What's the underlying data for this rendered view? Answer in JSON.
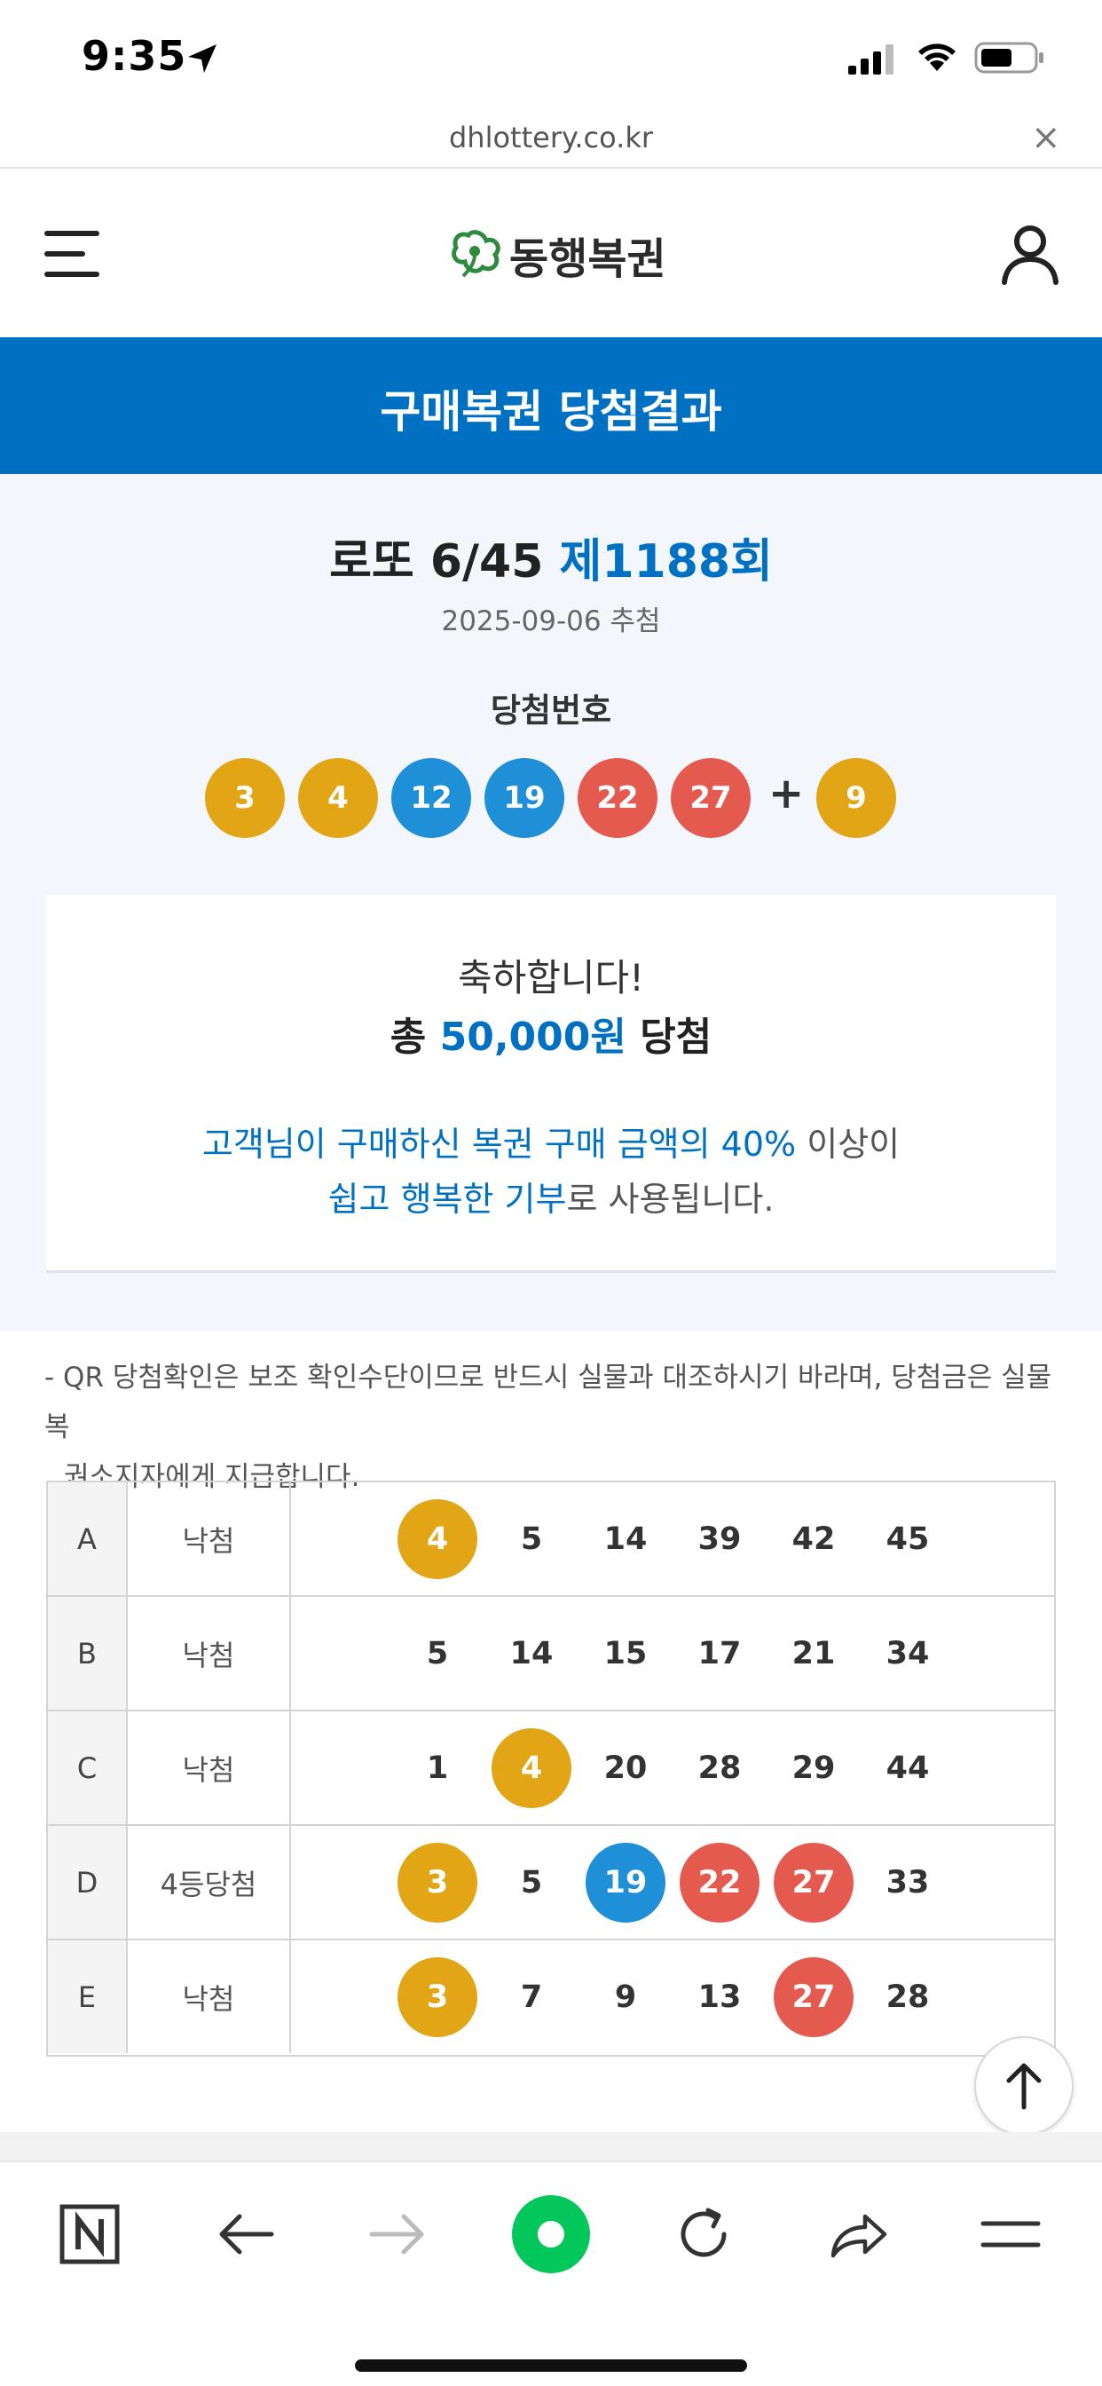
{
  "status_bar": {
    "time": "9:35"
  },
  "browser": {
    "url": "dhlottery.co.kr",
    "close_symbol": "×"
  },
  "header": {
    "logo_text": "동행복권"
  },
  "page_title": "구매복권 당첨결과",
  "draw": {
    "game_name": "로또 6/45",
    "round": "제1188회",
    "date": "2025-09-06 추첨",
    "winning_label": "당첨번호",
    "numbers": [
      "3",
      "4",
      "12",
      "19",
      "22",
      "27"
    ],
    "plus": "+",
    "bonus": "9"
  },
  "congrats": {
    "line1": "축하합니다!",
    "total_prefix": "총",
    "amount": "50,000원",
    "total_suffix": "당첨",
    "donation_hl1": "고객님이 구매하신 복권 구매 금액의 40%",
    "donation_text1": "이상이",
    "donation_hl2": "쉽고 행복한 기부",
    "donation_text2": "로 사용됩니다."
  },
  "notice": {
    "line1": "- QR 당첨확인은 보조 확인수단이므로 반드시 실물과 대조하시기 바라며, 당첨금은 실물 복",
    "line2": "권소지자에게 지급합니다."
  },
  "games": [
    {
      "id": "A",
      "result": "낙첨",
      "numbers": [
        "4",
        "5",
        "14",
        "39",
        "42",
        "45"
      ],
      "hits": [
        true,
        false,
        false,
        false,
        false,
        false
      ]
    },
    {
      "id": "B",
      "result": "낙첨",
      "numbers": [
        "5",
        "14",
        "15",
        "17",
        "21",
        "34"
      ],
      "hits": [
        false,
        false,
        false,
        false,
        false,
        false
      ]
    },
    {
      "id": "C",
      "result": "낙첨",
      "numbers": [
        "1",
        "4",
        "20",
        "28",
        "29",
        "44"
      ],
      "hits": [
        false,
        true,
        false,
        false,
        false,
        false
      ]
    },
    {
      "id": "D",
      "result": "4등당첨",
      "numbers": [
        "3",
        "5",
        "19",
        "22",
        "27",
        "33"
      ],
      "hits": [
        true,
        false,
        true,
        true,
        true,
        false
      ]
    },
    {
      "id": "E",
      "result": "낙첨",
      "numbers": [
        "3",
        "7",
        "9",
        "13",
        "27",
        "28"
      ],
      "hits": [
        true,
        false,
        false,
        false,
        true,
        false
      ]
    }
  ],
  "colors": {
    "brand_blue": "#0071c2",
    "ball_yellow": "#e2a516",
    "ball_blue": "#1f8fd8",
    "ball_red": "#e55a4e",
    "toolbar_green": "#03c75a"
  },
  "toolbar_icons": [
    "naver-n-icon",
    "back-arrow-icon",
    "forward-arrow-icon",
    "green-dot-icon",
    "reload-icon",
    "share-icon",
    "menu-icon"
  ]
}
